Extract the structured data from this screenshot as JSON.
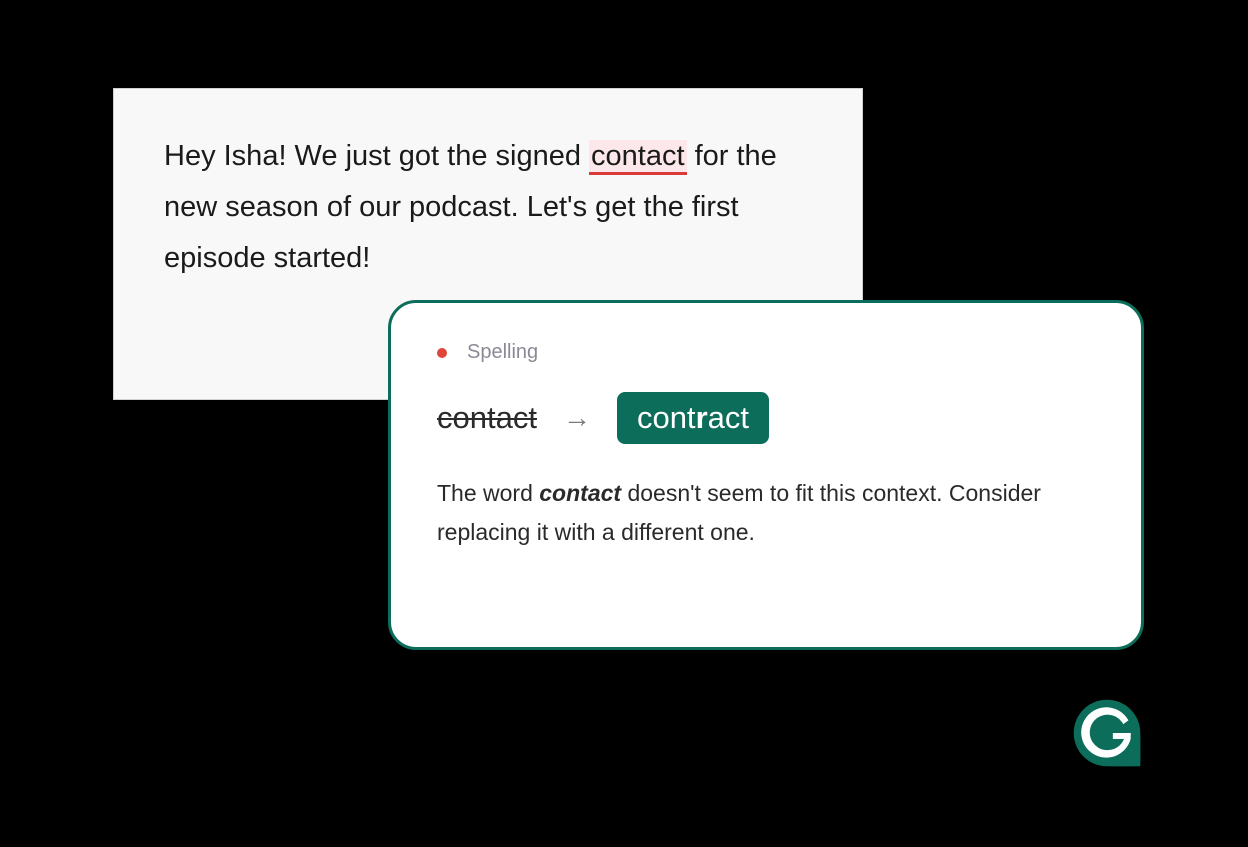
{
  "editor": {
    "text_before": "Hey Isha! We just got the signed ",
    "flagged_word": "contact",
    "text_after": " for the new season of our podcast. Let's get the first episode started!"
  },
  "suggestion": {
    "category": "Spelling",
    "original_word": "contact",
    "replacement_prefix": "cont",
    "replacement_bold": "r",
    "replacement_suffix": "act",
    "explanation_before": "The word ",
    "explanation_word": "contact",
    "explanation_after": " doesn't seem to fit this context. Consider replacing it with a different one."
  },
  "colors": {
    "accent": "#0c6e5a",
    "error": "#e0453a",
    "highlight_bg": "#fce8ea",
    "underline": "#d93a3a"
  }
}
